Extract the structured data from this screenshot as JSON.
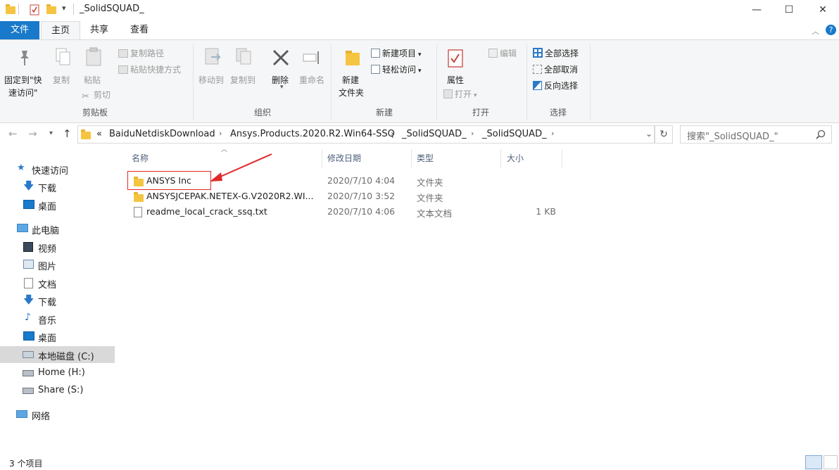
{
  "window": {
    "title": "_SolidSQUAD_",
    "minimize": "—",
    "maximize": "☐",
    "close": "✕"
  },
  "tabs": {
    "file": "文件",
    "home": "主页",
    "share": "共享",
    "view": "查看"
  },
  "ribbon": {
    "clipboard": {
      "pin": "固定到\"快",
      "pin2": "速访问\"",
      "copy": "复制",
      "paste": "粘贴",
      "copy_path": "复制路径",
      "paste_shortcut": "粘贴快捷方式",
      "cut": "剪切",
      "group": "剪贴板"
    },
    "organize": {
      "move_to": "移动到",
      "copy_to": "复制到",
      "delete": "删除",
      "rename": "重命名",
      "group": "组织"
    },
    "new": {
      "new_folder_1": "新建",
      "new_folder_2": "文件夹",
      "new_item": "新建项目",
      "easy_access": "轻松访问",
      "group": "新建"
    },
    "open": {
      "properties": "属性",
      "open": "打开",
      "edit": "编辑",
      "group": "打开"
    },
    "select": {
      "select_all": "全部选择",
      "select_none": "全部取消",
      "invert": "反向选择",
      "group": "选择"
    }
  },
  "address": {
    "overflow": "«",
    "crumbs": [
      "BaiduNetdiskDownload",
      "Ansys.Products.2020.R2.Win64-SSQ",
      "_SolidSQUAD_",
      "_SolidSQUAD_"
    ],
    "search_placeholder": "搜索\"_SolidSQUAD_\""
  },
  "nav": {
    "quick_access": "快速访问",
    "qa_downloads": "下载",
    "qa_desktop": "桌面",
    "this_pc": "此电脑",
    "videos": "视频",
    "pictures": "图片",
    "documents": "文档",
    "downloads": "下载",
    "music": "音乐",
    "desktop": "桌面",
    "local_disk": "本地磁盘 (C:)",
    "home": "Home (H:)",
    "share": "Share (S:)",
    "network": "网络"
  },
  "columns": {
    "name": "名称",
    "modified": "修改日期",
    "type": "类型",
    "size": "大小"
  },
  "files": [
    {
      "name": "ANSYS Inc",
      "modified": "2020/7/10 4:04",
      "type": "文件夹",
      "size": ""
    },
    {
      "name": "ANSYSJCEPAK.NETEX-G.V2020R2.WI...",
      "modified": "2020/7/10 3:52",
      "type": "文件夹",
      "size": ""
    },
    {
      "name": "readme_local_crack_ssq.txt",
      "modified": "2020/7/10 4:06",
      "type": "文本文档",
      "size": "1 KB"
    }
  ],
  "status": {
    "count": "3 个项目"
  },
  "colors": {
    "accent": "#1979ca",
    "annotation": "#e02a2a",
    "folder": "#f5c542"
  }
}
